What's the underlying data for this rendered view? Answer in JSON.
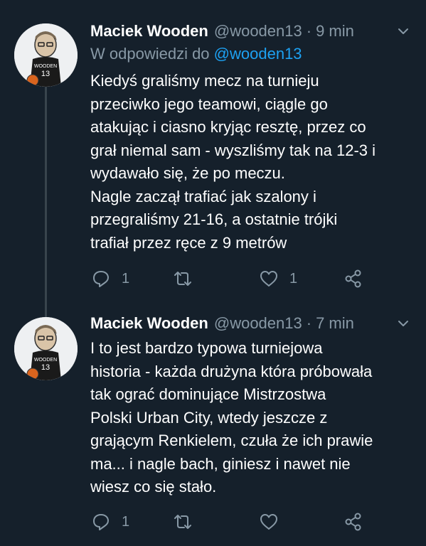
{
  "colors": {
    "background": "#15202b",
    "secondary_text": "#8899a6",
    "mention": "#1da1f2",
    "line": "#38444d"
  },
  "tweets": [
    {
      "name": "Maciek Wooden",
      "handle": "@wooden13",
      "separator": "·",
      "time": "9 min",
      "reply_prefix": "W odpowiedzi do",
      "reply_to": "@wooden13",
      "text": "Kiedyś graliśmy mecz na turnieju\nprzeciwko jego teamowi, ciągle go\natakując i ciasno kryjąc resztę, przez co\ngrał niemal sam - wyszliśmy tak na 12-3 i\nwydawało się, że po meczu.\nNagle zaczął trafiać jak szalony i\nprzegraliśmy 21-16, a ostatnie trójki\ntrafiał przez ręce z 9 metrów",
      "reply_count": "1",
      "retweet_count": "",
      "like_count": "1"
    },
    {
      "name": "Maciek Wooden",
      "handle": "@wooden13",
      "separator": "·",
      "time": "7 min",
      "text": "I to jest bardzo typowa turniejowa\nhistoria - każda drużyna która próbowała\ntak ograć dominujące Mistrzostwa\nPolski Urban City, wtedy jeszcze z\ngrającym Renkielem, czuła że ich prawie\nma... i nagle bach, giniesz i nawet nie\nwiesz co się stało.",
      "reply_count": "1",
      "retweet_count": "",
      "like_count": ""
    }
  ],
  "icons": {
    "reply": "reply-icon",
    "retweet": "retweet-icon",
    "like": "heart-icon",
    "share": "share-icon",
    "menu": "chevron-down-icon"
  }
}
